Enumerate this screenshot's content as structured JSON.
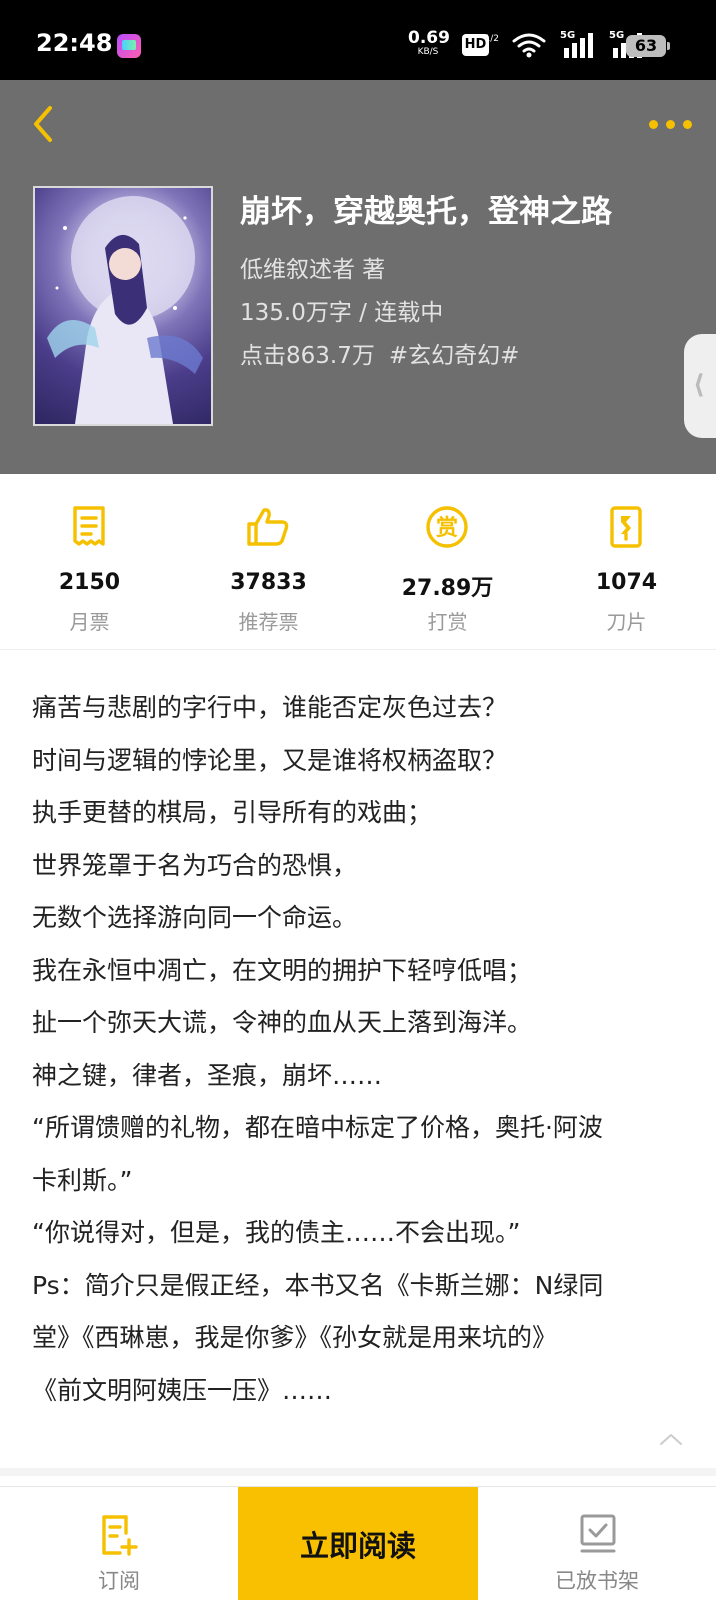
{
  "status_bar": {
    "time": "22:48",
    "net_speed_value": "0.69",
    "net_speed_unit": "KB/S",
    "hd_badge": "HD",
    "hd_sub": "1/2",
    "signal1_tag": "5G",
    "signal2_tag": "5G",
    "battery": "63"
  },
  "header": {
    "back_icon": "chevron-left-icon",
    "more_icon": "more-dots-icon",
    "accent_color": "#f5c000",
    "background_color": "#6e6e6e"
  },
  "book": {
    "title": "崩坏，穿越奥托，登神之路",
    "author_line": "低维叙述者  著",
    "words_status": "135.0万字 / 连载中",
    "clicks": "点击863.7万",
    "tag": "#玄幻奇幻#"
  },
  "stats": [
    {
      "icon": "monthly-ticket-icon",
      "value": "2150",
      "label": "月票"
    },
    {
      "icon": "thumbs-up-icon",
      "value": "37833",
      "label": "推荐票"
    },
    {
      "icon": "reward-coin-icon",
      "value": "27.89万",
      "label": "打赏"
    },
    {
      "icon": "blade-card-icon",
      "value": "1074",
      "label": "刀片"
    }
  ],
  "synopsis": [
    "痛苦与悲剧的字行中，谁能否定灰色过去？",
    "时间与逻辑的悖论里，又是谁将权柄盗取？",
    "执手更替的棋局，引导所有的戏曲；",
    "世界笼罩于名为巧合的恐惧，",
    "无数个选择游向同一个命运。",
    "我在永恒中凋亡，在文明的拥护下轻哼低唱；",
    "扯一个弥天大谎，令神的血从天上落到海洋。",
    "神之键，律者，圣痕，崩坏……",
    "“所谓馈赠的礼物，都在暗中标定了价格，奥托·阿波",
    "卡利斯。”",
    "“你说得对，但是，我的债主……不会出现。”",
    "Ps：简介只是假正经，本书又名《卡斯兰娜：N绿同",
    "堂》《西琳崽，我是你爹》《孙女就是用来坑的》",
    "《前文明阿姨压一压》……"
  ],
  "bottom_bar": {
    "subscribe_label": "订阅",
    "read_label": "立即阅读",
    "shelf_label": "已放书架",
    "read_color": "#f8c000"
  }
}
